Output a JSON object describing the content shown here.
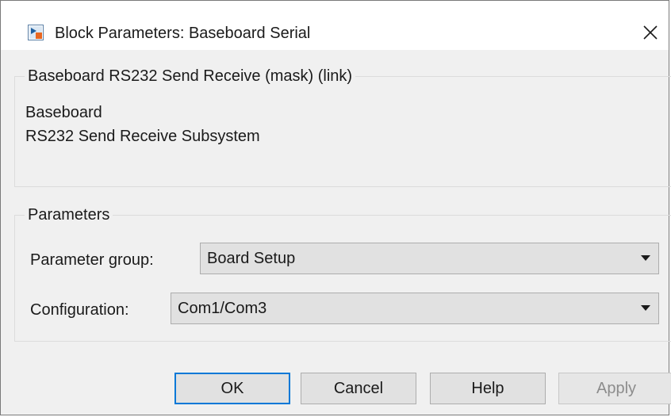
{
  "window": {
    "title": "Block Parameters: Baseboard Serial",
    "icon": "simulink-block-icon",
    "close_glyph": "✕"
  },
  "description_group": {
    "legend": "Baseboard RS232 Send Receive (mask) (link)",
    "line1": "Baseboard",
    "line2": "RS232 Send Receive Subsystem"
  },
  "parameters_group": {
    "legend": "Parameters",
    "parameter_group": {
      "label": "Parameter group:",
      "value": "Board Setup"
    },
    "configuration": {
      "label": "Configuration:",
      "value": "Com1/Com3"
    }
  },
  "buttons": {
    "ok": "OK",
    "cancel": "Cancel",
    "help": "Help",
    "apply": "Apply"
  },
  "colors": {
    "window_bg": "#f0f0f0",
    "titlebar_bg": "#ffffff",
    "focus_border": "#0078d7",
    "disabled_text": "#8c8c8c"
  }
}
